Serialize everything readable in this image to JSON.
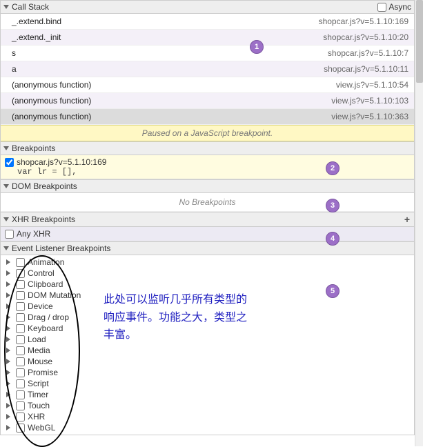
{
  "callstack": {
    "title": "Call Stack",
    "async_label": "Async",
    "frames": [
      {
        "fn": "_.extend.bind",
        "src": "shopcar.js?v=5.1.10:169"
      },
      {
        "fn": "_.extend._init",
        "src": "shopcar.js?v=5.1.10:20"
      },
      {
        "fn": "s",
        "src": "shopcar.js?v=5.1.10:7"
      },
      {
        "fn": "a",
        "src": "shopcar.js?v=5.1.10:11"
      },
      {
        "fn": "(anonymous function)",
        "src": "view.js?v=5.1.10:54"
      },
      {
        "fn": "(anonymous function)",
        "src": "view.js?v=5.1.10:103"
      },
      {
        "fn": "(anonymous function)",
        "src": "view.js?v=5.1.10:363"
      }
    ],
    "paused_msg": "Paused on a JavaScript breakpoint."
  },
  "breakpoints": {
    "title": "Breakpoints",
    "items": [
      {
        "loc": "shopcar.js?v=5.1.10:169",
        "code": "var lr = [],"
      }
    ]
  },
  "dom_bp": {
    "title": "DOM Breakpoints",
    "empty": "No Breakpoints"
  },
  "xhr_bp": {
    "title": "XHR Breakpoints",
    "anyxhr": "Any XHR"
  },
  "event_bp": {
    "title": "Event Listener Breakpoints",
    "items": [
      "Animation",
      "Control",
      "Clipboard",
      "DOM Mutation",
      "Device",
      "Drag / drop",
      "Keyboard",
      "Load",
      "Media",
      "Mouse",
      "Promise",
      "Script",
      "Timer",
      "Touch",
      "XHR",
      "WebGL"
    ]
  },
  "annotation": "此处可以监听几乎所有类型的响应事件。功能之大，类型之丰富。",
  "badges": [
    "1",
    "2",
    "3",
    "4",
    "5"
  ]
}
